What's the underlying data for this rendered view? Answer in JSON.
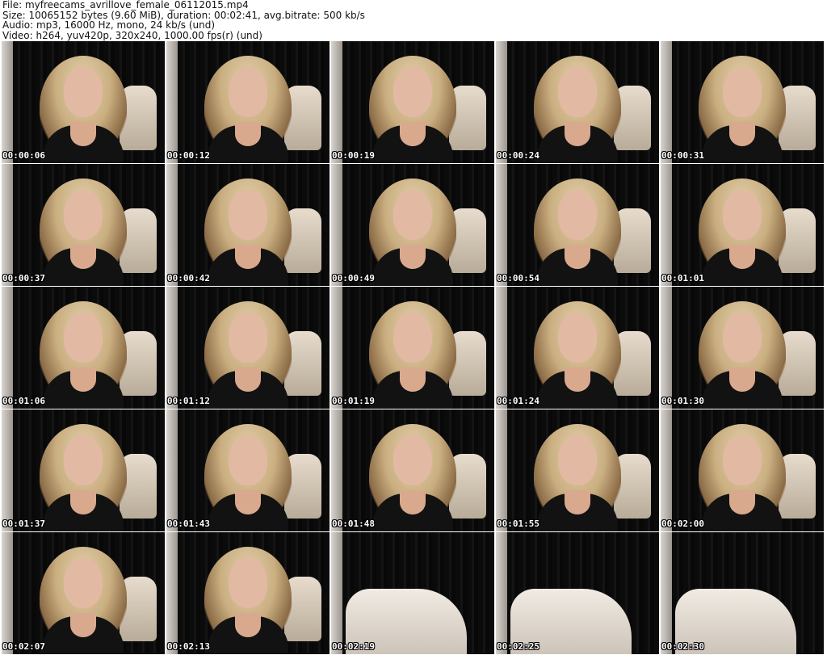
{
  "header": {
    "file_line": "File: myfreecams_avrillove_female_06112015.mp4",
    "size_line": "Size: 10065152 bytes (9.60 MiB), duration: 00:02:41, avg.bitrate: 500 kb/s",
    "audio_line": "Audio: mp3, 16000 Hz, mono, 24 kb/s (und)",
    "video_line": "Video: h264, yuv420p, 320x240, 1000.00 fps(r) (und)"
  },
  "thumbnails": [
    {
      "ts": "00:00:06"
    },
    {
      "ts": "00:00:12"
    },
    {
      "ts": "00:00:19"
    },
    {
      "ts": "00:00:24"
    },
    {
      "ts": "00:00:31"
    },
    {
      "ts": "00:00:37"
    },
    {
      "ts": "00:00:42"
    },
    {
      "ts": "00:00:49"
    },
    {
      "ts": "00:00:54"
    },
    {
      "ts": "00:01:01"
    },
    {
      "ts": "00:01:06"
    },
    {
      "ts": "00:01:12"
    },
    {
      "ts": "00:01:19"
    },
    {
      "ts": "00:01:24"
    },
    {
      "ts": "00:01:30"
    },
    {
      "ts": "00:01:37"
    },
    {
      "ts": "00:01:43"
    },
    {
      "ts": "00:01:48"
    },
    {
      "ts": "00:01:55"
    },
    {
      "ts": "00:02:00"
    },
    {
      "ts": "00:02:07"
    },
    {
      "ts": "00:02:13"
    },
    {
      "ts": "00:02:19"
    },
    {
      "ts": "00:02:25"
    },
    {
      "ts": "00:02:30"
    }
  ]
}
